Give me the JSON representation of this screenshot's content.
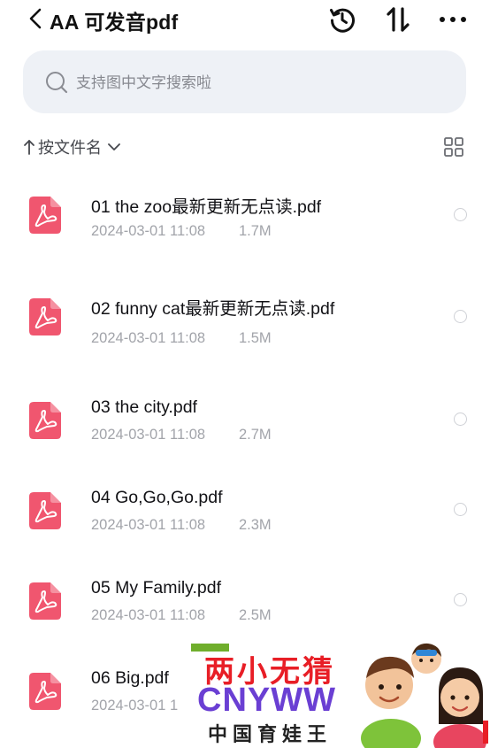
{
  "header": {
    "title": "AA 可发音pdf",
    "icons": [
      "chevron-left-icon",
      "history-icon",
      "sort-arrows-icon",
      "more-icon"
    ]
  },
  "search": {
    "placeholder": "支持图中文字搜索啦",
    "value": ""
  },
  "sort": {
    "label": "按文件名",
    "direction": "ascending"
  },
  "view": {
    "mode": "list"
  },
  "colors": {
    "pdf_icon": "#f0566f",
    "search_bg": "#eef1f6",
    "muted_text": "#a2a4aa"
  },
  "files": [
    {
      "name": "01 the zoo最新更新无点读.pdf",
      "date": "2024-03-01 11:08",
      "size": "1.7M"
    },
    {
      "name": "02 funny cat最新更新无点读.pdf",
      "date": "2024-03-01 11:08",
      "size": "1.5M"
    },
    {
      "name": "03 the city.pdf",
      "date": "2024-03-01 11:08",
      "size": "2.7M"
    },
    {
      "name": "04 Go,Go,Go.pdf",
      "date": "2024-03-01 11:08",
      "size": "2.3M"
    },
    {
      "name": "05 My Family.pdf",
      "date": "2024-03-01 11:08",
      "size": "2.5M"
    },
    {
      "name": "06 Big.pdf",
      "date": "2024-03-01 1",
      "size": ""
    }
  ],
  "watermark": {
    "line1": "两小无猜",
    "line2": "CNYWW",
    "line3": "中国育娃王"
  }
}
